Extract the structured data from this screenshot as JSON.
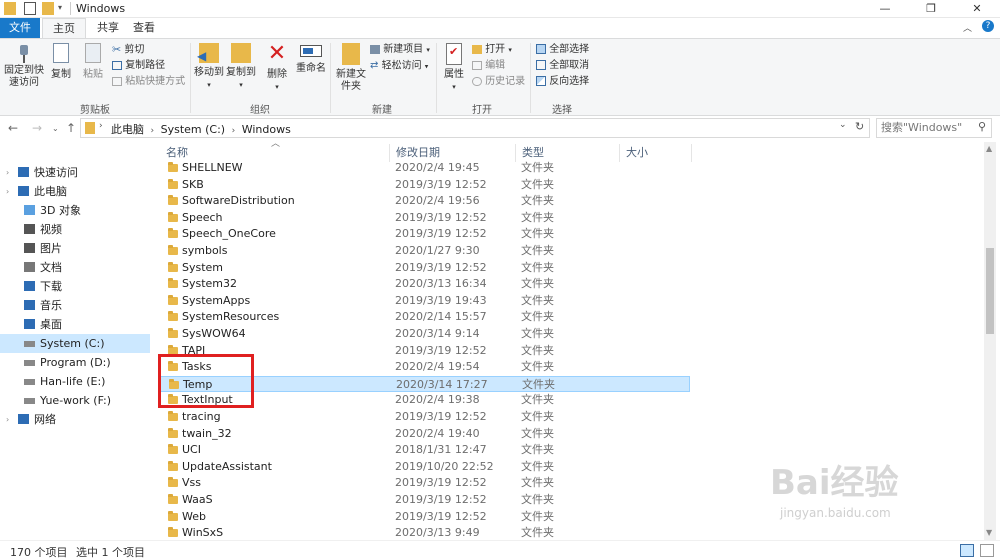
{
  "window": {
    "title": "Windows",
    "minimize": "—",
    "maximize": "❐",
    "close": "✕"
  },
  "tabs": [
    "文件",
    "主页",
    "共享",
    "查看"
  ],
  "ribbon": {
    "clipboard": {
      "pin": "固定到快速访问",
      "copy": "复制",
      "paste": "粘贴",
      "cut": "剪切",
      "copy_path": "复制路径",
      "paste_shortcut": "粘贴快捷方式",
      "label": "剪贴板"
    },
    "organize": {
      "move_to": "移动到",
      "copy_to": "复制到",
      "delete": "删除",
      "rename": "重命名",
      "label": "组织"
    },
    "new": {
      "new_folder": "新建文件夹",
      "new_item": "新建项目",
      "easy_access": "轻松访问",
      "label": "新建"
    },
    "open": {
      "properties": "属性",
      "open": "打开",
      "edit": "编辑",
      "history": "历史记录",
      "label": "打开"
    },
    "select": {
      "select_all": "全部选择",
      "select_none": "全部取消",
      "invert": "反向选择",
      "label": "选择"
    }
  },
  "address": {
    "path": [
      "此电脑",
      "System (C:)",
      "Windows"
    ],
    "search_placeholder": "搜索\"Windows\""
  },
  "nav": [
    {
      "label": "快速访问",
      "icon": "star-icon"
    },
    {
      "label": "此电脑",
      "icon": "computer-icon"
    },
    {
      "label": "3D 对象",
      "icon": "cube-icon"
    },
    {
      "label": "视频",
      "icon": "video-icon"
    },
    {
      "label": "图片",
      "icon": "picture-icon"
    },
    {
      "label": "文档",
      "icon": "document-icon"
    },
    {
      "label": "下载",
      "icon": "download-icon"
    },
    {
      "label": "音乐",
      "icon": "music-icon"
    },
    {
      "label": "桌面",
      "icon": "desktop-icon"
    },
    {
      "label": "System (C:)",
      "icon": "drive-icon"
    },
    {
      "label": "Program (D:)",
      "icon": "drive-icon"
    },
    {
      "label": "Han-life (E:)",
      "icon": "drive-icon"
    },
    {
      "label": "Yue-work (F:)",
      "icon": "drive-icon"
    },
    {
      "label": "网络",
      "icon": "network-icon"
    }
  ],
  "columns": [
    "名称",
    "修改日期",
    "类型",
    "大小"
  ],
  "files": [
    {
      "name": "SHELLNEW",
      "date": "2020/2/4 19:45",
      "type": "文件夹"
    },
    {
      "name": "SKB",
      "date": "2019/3/19 12:52",
      "type": "文件夹"
    },
    {
      "name": "SoftwareDistribution",
      "date": "2020/2/4 19:56",
      "type": "文件夹"
    },
    {
      "name": "Speech",
      "date": "2019/3/19 12:52",
      "type": "文件夹"
    },
    {
      "name": "Speech_OneCore",
      "date": "2019/3/19 12:52",
      "type": "文件夹"
    },
    {
      "name": "symbols",
      "date": "2020/1/27 9:30",
      "type": "文件夹"
    },
    {
      "name": "System",
      "date": "2019/3/19 12:52",
      "type": "文件夹"
    },
    {
      "name": "System32",
      "date": "2020/3/13 16:34",
      "type": "文件夹"
    },
    {
      "name": "SystemApps",
      "date": "2019/3/19 19:43",
      "type": "文件夹"
    },
    {
      "name": "SystemResources",
      "date": "2020/2/14 15:57",
      "type": "文件夹"
    },
    {
      "name": "SysWOW64",
      "date": "2020/3/14 9:14",
      "type": "文件夹"
    },
    {
      "name": "TAPI",
      "date": "2019/3/19 12:52",
      "type": "文件夹"
    },
    {
      "name": "Tasks",
      "date": "2020/2/4 19:54",
      "type": "文件夹"
    },
    {
      "name": "Temp",
      "date": "2020/3/14 17:27",
      "type": "文件夹"
    },
    {
      "name": "TextInput",
      "date": "2020/2/4 19:38",
      "type": "文件夹"
    },
    {
      "name": "tracing",
      "date": "2019/3/19 12:52",
      "type": "文件夹"
    },
    {
      "name": "twain_32",
      "date": "2020/2/4 19:40",
      "type": "文件夹"
    },
    {
      "name": "UCI",
      "date": "2018/1/31 12:47",
      "type": "文件夹"
    },
    {
      "name": "UpdateAssistant",
      "date": "2019/10/20 22:52",
      "type": "文件夹"
    },
    {
      "name": "Vss",
      "date": "2019/3/19 12:52",
      "type": "文件夹"
    },
    {
      "name": "WaaS",
      "date": "2019/3/19 12:52",
      "type": "文件夹"
    },
    {
      "name": "Web",
      "date": "2019/3/19 12:52",
      "type": "文件夹"
    },
    {
      "name": "WinSxS",
      "date": "2020/3/13 9:49",
      "type": "文件夹"
    }
  ],
  "selected_index": 13,
  "status": {
    "count": "170 个项目",
    "selected": "选中 1 个项目"
  },
  "watermark": {
    "brand": "Bai经验",
    "url": "jingyan.baidu.com"
  },
  "colors": {
    "accent": "#1979ca",
    "selection": "#cce8ff",
    "highlight_box": "#e02020"
  }
}
